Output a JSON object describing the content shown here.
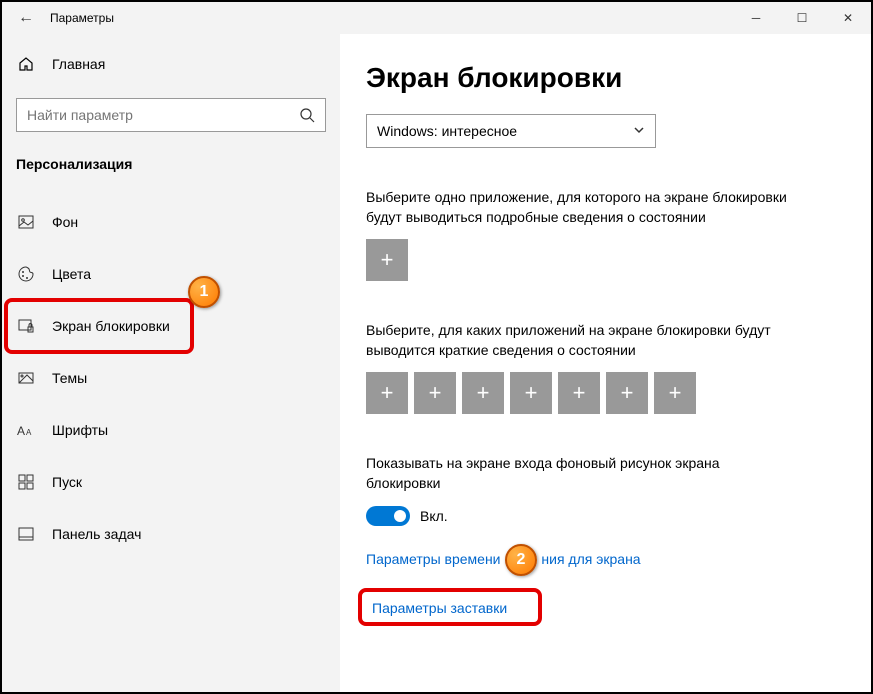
{
  "titlebar": {
    "title": "Параметры"
  },
  "sidebar": {
    "home": "Главная",
    "search_placeholder": "Найти параметр",
    "section": "Персонализация",
    "items": [
      {
        "label": "Фон"
      },
      {
        "label": "Цвета"
      },
      {
        "label": "Экран блокировки"
      },
      {
        "label": "Темы"
      },
      {
        "label": "Шрифты"
      },
      {
        "label": "Пуск"
      },
      {
        "label": "Панель задач"
      }
    ]
  },
  "main": {
    "heading": "Экран блокировки",
    "dropdown_value": "Windows: интересное",
    "desc1": "Выберите одно приложение, для которого на экране блокировки будут выводиться подробные сведения о состоянии",
    "desc2": "Выберите, для каких приложений на экране блокировки будут выводится краткие сведения о состоянии",
    "toggle_desc": "Показывать на экране входа фоновый рисунок экрана блокировки",
    "toggle_label": "Вкл.",
    "link1_a": "Параметры времени",
    "link1_b": "ния для экрана",
    "link2": "Параметры заставки"
  },
  "badges": {
    "b1": "1",
    "b2": "2"
  }
}
